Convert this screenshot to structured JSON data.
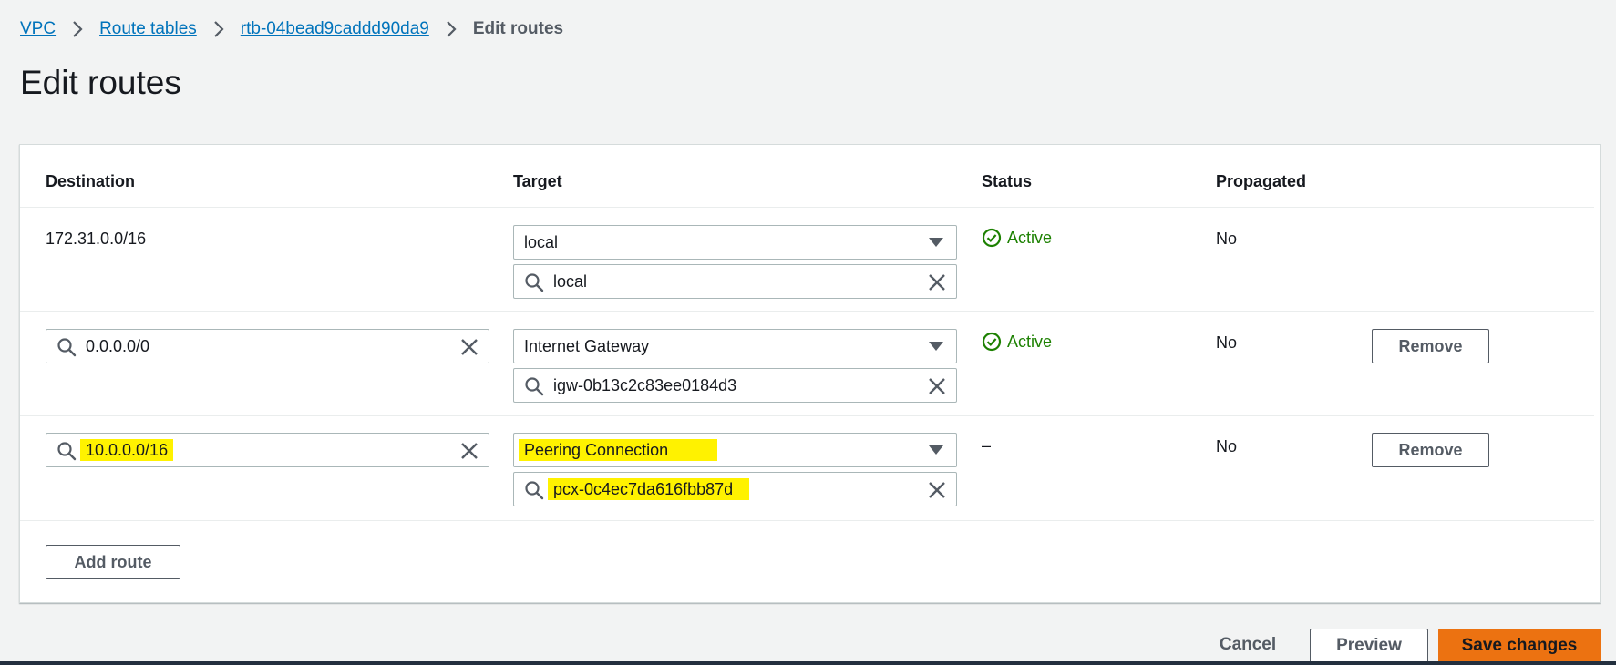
{
  "breadcrumb": {
    "vpc": "VPC",
    "route_tables": "Route tables",
    "route_table_id": "rtb-04bead9caddd90da9",
    "current": "Edit routes"
  },
  "page_title": "Edit routes",
  "table": {
    "headers": {
      "destination": "Destination",
      "target": "Target",
      "status": "Status",
      "propagated": "Propagated"
    },
    "rows": [
      {
        "destination": "172.31.0.0/16",
        "target_type": "local",
        "target_search": "local",
        "status": "Active",
        "propagated": "No"
      },
      {
        "destination": "0.0.0.0/0",
        "target_type": "Internet Gateway",
        "target_search": "igw-0b13c2c83ee0184d3",
        "status": "Active",
        "propagated": "No",
        "remove_label": "Remove"
      },
      {
        "destination": "10.0.0.0/16",
        "target_type": "Peering Connection",
        "target_search": "pcx-0c4ec7da616fbb87d",
        "status": "–",
        "propagated": "No",
        "remove_label": "Remove"
      }
    ],
    "add_route_label": "Add route"
  },
  "footer": {
    "cancel_label": "Cancel",
    "preview_label": "Preview",
    "save_label": "Save changes"
  },
  "colors": {
    "link": "#0073bb",
    "status_active": "#1d8102",
    "primary_button": "#ec7211",
    "highlight": "#fff200"
  },
  "icons": {
    "breadcrumb_separator": "chevron-right-icon",
    "search": "search-icon",
    "clear": "close-icon",
    "dropdown": "caret-down-icon",
    "status": "check-circle-icon"
  }
}
